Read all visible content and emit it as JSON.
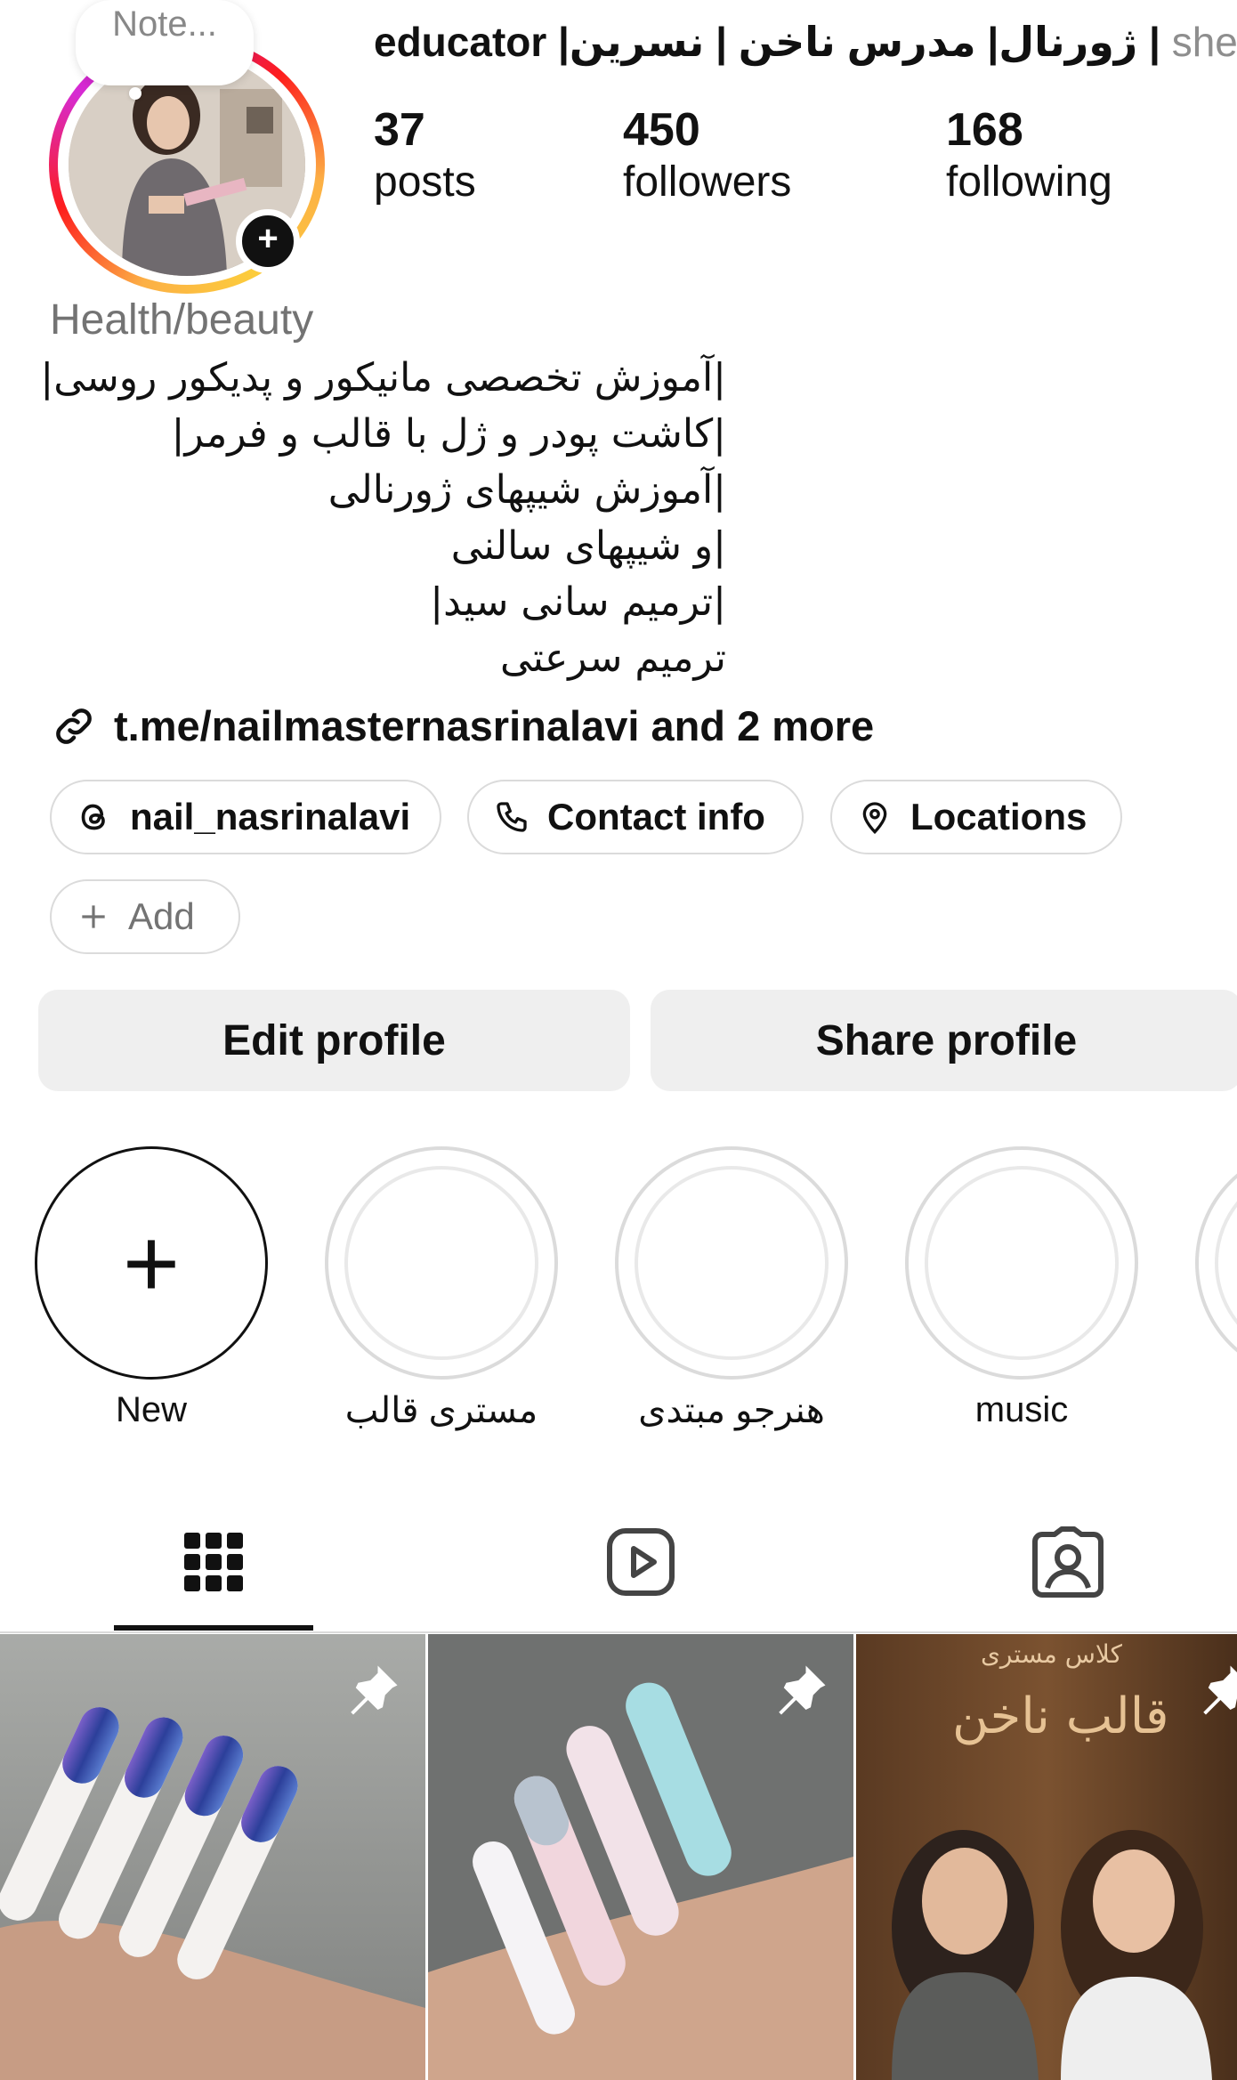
{
  "profile": {
    "note": "Note...",
    "display_name": "educator |ژورنال| مدرس ناخن | نسرین |",
    "pronouns": "she",
    "stats": [
      {
        "num": "37",
        "label": "posts"
      },
      {
        "num": "450",
        "label": "followers"
      },
      {
        "num": "168",
        "label": "following"
      }
    ],
    "category": "Health/beauty",
    "bio_lines": [
      "|آموزش تخصصی مانیکور و پدیکور روسی|",
      "|کاشت پودر و ژل با قالب و فرمر|",
      "|آموزش شیپهای ژورنالی",
      "|و شیپهای سالنی",
      "|ترمیم سانی سید|",
      "ترمیم سرعتی"
    ],
    "link": "t.me/nailmasternasrinalavi and 2 more"
  },
  "chips": {
    "threads": "nail_nasrinalavi",
    "contact": "Contact info",
    "locations": "Locations",
    "add": "Add"
  },
  "buttons": {
    "edit": "Edit profile",
    "share": "Share profile"
  },
  "highlights": [
    {
      "label": "New"
    },
    {
      "label": "مستری قالب"
    },
    {
      "label": "هنرجو مبتدی"
    },
    {
      "label": "music"
    }
  ],
  "posts": [
    {
      "caption": ""
    },
    {
      "caption": ""
    },
    {
      "caption_top": "کلاس مستری",
      "caption_title": "قالب ناخن"
    }
  ],
  "icons": {
    "tabs": [
      "grid-icon",
      "reels-icon",
      "tagged-icon"
    ],
    "pinned": "pin-icon"
  }
}
